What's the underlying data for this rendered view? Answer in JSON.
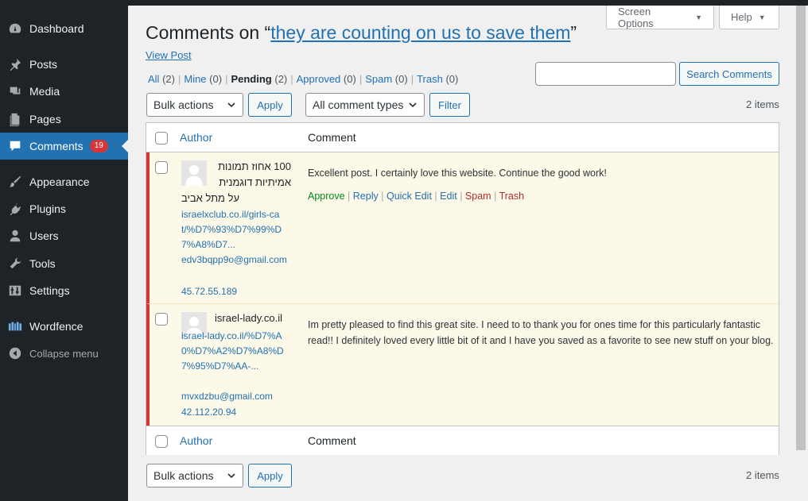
{
  "sidebar": {
    "items": [
      {
        "label": "Dashboard",
        "icon": "dashboard-icon"
      },
      {
        "label": "Posts",
        "icon": "pin-icon"
      },
      {
        "label": "Media",
        "icon": "media-icon"
      },
      {
        "label": "Pages",
        "icon": "pages-icon"
      },
      {
        "label": "Comments",
        "icon": "comment-bubble-icon",
        "badge": "19"
      },
      {
        "label": "Appearance",
        "icon": "brush-icon"
      },
      {
        "label": "Plugins",
        "icon": "plug-icon"
      },
      {
        "label": "Users",
        "icon": "user-icon"
      },
      {
        "label": "Tools",
        "icon": "wrench-icon"
      },
      {
        "label": "Settings",
        "icon": "sliders-icon"
      },
      {
        "label": "Wordfence",
        "icon": "wordfence-icon"
      },
      {
        "label": "Collapse menu",
        "icon": "collapse-icon"
      }
    ]
  },
  "header": {
    "screen_options": "Screen Options",
    "help": "Help",
    "title_prefix": "Comments on “",
    "title_link": "they are counting on us to save them",
    "title_suffix": "”",
    "view_post": "View Post"
  },
  "filters": {
    "all": {
      "label": "All",
      "count": "(2)"
    },
    "mine": {
      "label": "Mine",
      "count": "(0)"
    },
    "pending": {
      "label": "Pending",
      "count": "(2)"
    },
    "approved": {
      "label": "Approved",
      "count": "(0)"
    },
    "spam": {
      "label": "Spam",
      "count": "(0)"
    },
    "trash": {
      "label": "Trash",
      "count": "(0)"
    },
    "separator": "|"
  },
  "search": {
    "value": "",
    "button": "Search Comments"
  },
  "toolbar": {
    "bulk_actions": "Bulk actions",
    "apply": "Apply",
    "comment_types": "All comment types",
    "filter": "Filter",
    "items": "2 items"
  },
  "table": {
    "col_author": "Author",
    "col_comment": "Comment",
    "rows": [
      {
        "author_line1": "100 אחוז תמונות",
        "author_line2": "אמיתיות דוגמנית",
        "author_line3": "על מתל אביב",
        "url": "israelxclub.co.il/girls-cat/%D7%93%D7%99%D7%A8%D7...",
        "email": "edv3bqpp9o@gmail.com",
        "ip": "45.72.55.189",
        "comment": "Excellent post. I certainly love this website. Continue the good work!"
      },
      {
        "author_line1": "israel-lady.co.il",
        "url": "israel-lady.co.il/%D7%A0%D7%A2%D7%A8%D7%95%D7%AA-...",
        "email": "mvxdzbu@gmail.com",
        "ip": "42.112.20.94",
        "comment": "Im pretty pleased to find this great site. I need to to thank you for ones time for this particularly fantastic read!! I definitely loved every little bit of it and I have you saved as a favorite to see new stuff on your blog."
      }
    ],
    "actions": {
      "approve": "Approve",
      "reply": "Reply",
      "quick_edit": "Quick Edit",
      "edit": "Edit",
      "spam": "Spam",
      "trash": "Trash",
      "sep": "|"
    }
  },
  "colors": {
    "sidebar_bg": "#1d2327",
    "accent": "#2271b1",
    "pending_row": "#fcf9e8",
    "pending_border": "#d63638"
  }
}
